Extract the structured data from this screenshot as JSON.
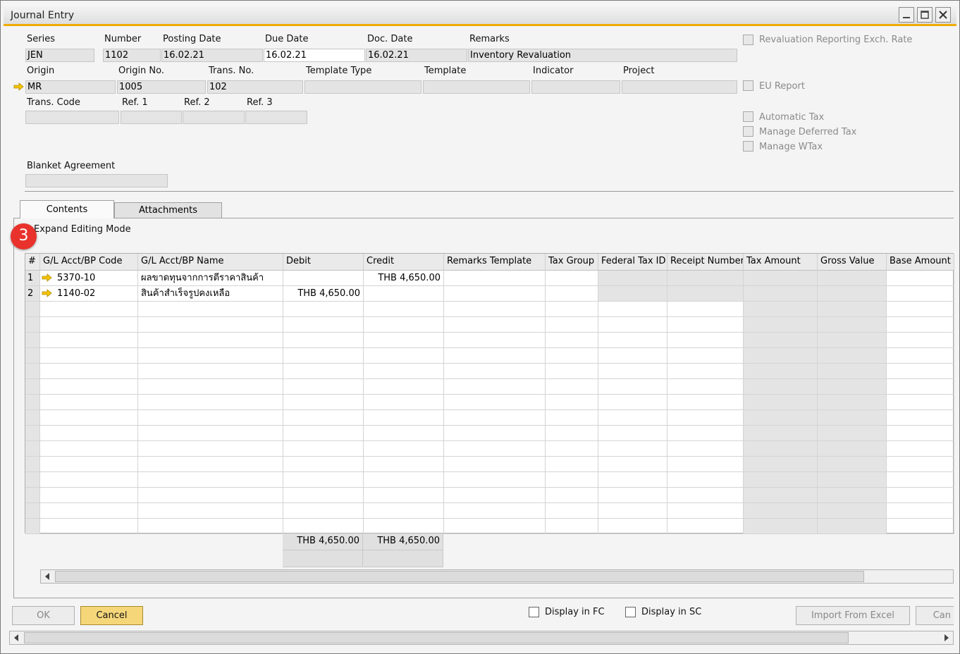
{
  "window": {
    "title": "Journal Entry"
  },
  "header": {
    "series": {
      "label": "Series",
      "value": "JEN"
    },
    "number": {
      "label": "Number",
      "value": "1102"
    },
    "posting_date": {
      "label": "Posting Date",
      "value": "16.02.21"
    },
    "due_date": {
      "label": "Due Date",
      "value": "16.02.21"
    },
    "doc_date": {
      "label": "Doc. Date",
      "value": "16.02.21"
    },
    "remarks": {
      "label": "Remarks",
      "value": "Inventory Revaluation"
    },
    "origin": {
      "label": "Origin",
      "value": "MR"
    },
    "origin_no": {
      "label": "Origin No.",
      "value": "1005"
    },
    "trans_no": {
      "label": "Trans. No.",
      "value": "102"
    },
    "template_type": {
      "label": "Template Type",
      "value": ""
    },
    "template": {
      "label": "Template",
      "value": ""
    },
    "indicator": {
      "label": "Indicator",
      "value": ""
    },
    "project": {
      "label": "Project",
      "value": ""
    },
    "trans_code": {
      "label": "Trans. Code",
      "value": ""
    },
    "ref1": {
      "label": "Ref. 1",
      "value": ""
    },
    "ref2": {
      "label": "Ref. 2",
      "value": ""
    },
    "ref3": {
      "label": "Ref. 3",
      "value": ""
    },
    "blanket_agreement": {
      "label": "Blanket Agreement",
      "value": ""
    }
  },
  "options": {
    "revaluation": "Revaluation Reporting Exch. Rate",
    "eu_report": "EU Report",
    "automatic_tax": "Automatic Tax",
    "manage_deferred_tax": "Manage Deferred Tax",
    "manage_wtax": "Manage WTax"
  },
  "tabs": {
    "contents": "Contents",
    "attachments": "Attachments"
  },
  "expand_editing_mode": "Expand Editing Mode",
  "step_badge": "3",
  "grid": {
    "columns": [
      "#",
      "G/L Acct/BP Code",
      "G/L Acct/BP Name",
      "Debit",
      "Credit",
      "Remarks Template",
      "Tax Group",
      "Federal Tax ID",
      "Receipt Number",
      "Tax Amount",
      "Gross Value",
      "Base Amount"
    ],
    "rows": [
      {
        "num": "1",
        "code": "5370-10",
        "name": "ผลขาดทุนจากการตีราคาสินค้า",
        "debit": "",
        "credit": "THB 4,650.00"
      },
      {
        "num": "2",
        "code": "1140-02",
        "name": "สินค้าสำเร็จรูปคงเหลือ",
        "debit": "THB 4,650.00",
        "credit": ""
      }
    ],
    "totals": {
      "debit": "THB 4,650.00",
      "credit": "THB 4,650.00"
    }
  },
  "footer": {
    "ok": "OK",
    "cancel": "Cancel",
    "display_fc": "Display in FC",
    "display_sc": "Display in SC",
    "import_excel": "Import From Excel",
    "cancel_partial": "Can"
  },
  "colors": {
    "accent": "#f0ab00",
    "cancel_button": "#f5d77a",
    "badge": "#e8322b"
  }
}
